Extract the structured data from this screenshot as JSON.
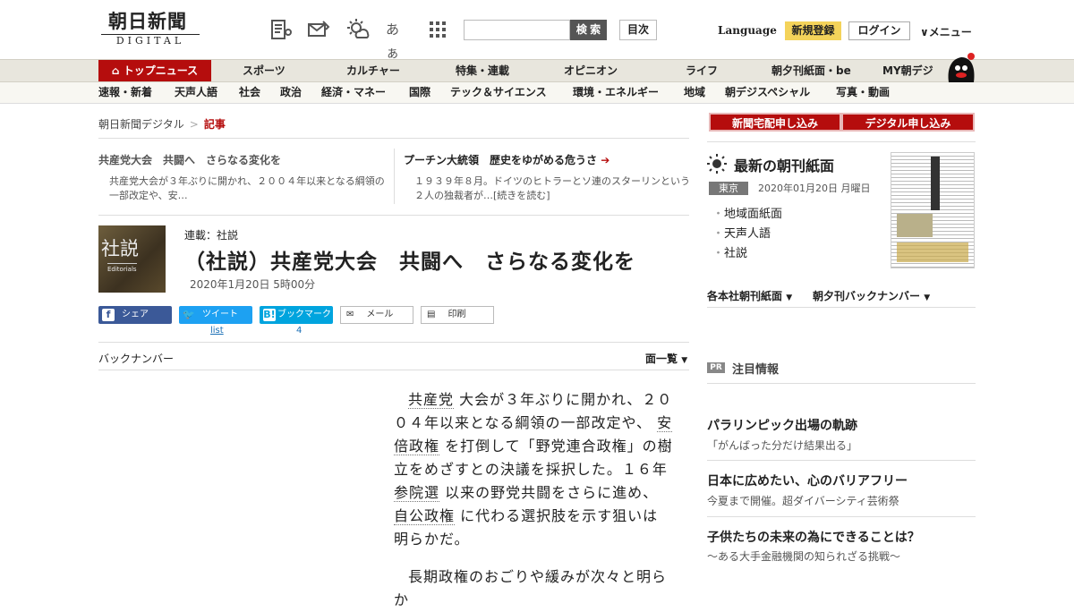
{
  "header": {
    "logo_main": "朝日新聞",
    "logo_sub": "DIGITAL",
    "icon_font_size": "あぁ",
    "search_button": "検 索",
    "toc_button": "目次",
    "language": "Language",
    "register": "新規登録",
    "login": "ログイン",
    "menu": "メニュー"
  },
  "nav_primary": {
    "top_news": "トップニュース",
    "items": [
      "スポーツ",
      "カルチャー",
      "特集・連載",
      "オピニオン",
      "ライフ",
      "朝夕刊紙面・be",
      "MY朝デジ"
    ]
  },
  "nav_secondary": {
    "items": [
      "速報・新着",
      "天声人語",
      "社会",
      "政治",
      "経済・マネー",
      "国際",
      "テック＆サイエンス",
      "環境・エネルギー",
      "地域",
      "朝デジスペシャル",
      "写真・動画"
    ]
  },
  "breadcrumb": {
    "home": "朝日新聞デジタル",
    "sep": ">",
    "current": "記事"
  },
  "related": [
    {
      "title": "共産党大会　共闘へ　さらなる変化を",
      "summary": "共産党大会が３年ぶりに開かれ、２００４年以来となる綱領の一部改定や、安…"
    },
    {
      "title": "プーチン大統領　歴史をゆがめる危うさ",
      "summary": "１９３９年８月。ドイツのヒトラーとソ連のスターリンという２人の独裁者が…",
      "more": "[続きを読む]"
    }
  ],
  "article": {
    "thumb_kanji": "社説",
    "thumb_en": "Editorials",
    "series": "連載：社説",
    "title": "（社説）共産党大会　共闘へ　さらなる変化を",
    "date": "2020年1月20日 5時00分",
    "share": {
      "facebook": "シェア",
      "twitter": "ツイート",
      "twitter_list": "list",
      "hatena": "ブックマーク",
      "hatena_count": "4",
      "mail": "メール",
      "print": "印刷"
    },
    "backnumber": "バックナンバー",
    "men_list": "面一覧",
    "body": [
      [
        "共産党",
        "大会が３年ぶりに開かれ、２００４年以来となる綱領の一部改定や、",
        "安倍政権",
        "を打倒して「野党連合政権」の樹立をめざすとの決議を採択した。１６年",
        "参院選",
        "以来の野党共闘をさらに進め、",
        "自公政権",
        "に代わる選択肢を示す狙いは明らかだ。"
      ],
      [
        "長期政権のおごりや緩みが次々と明らか"
      ]
    ]
  },
  "sidebar": {
    "subscribe_home": "新聞宅配申し込み",
    "subscribe_digital": "デジタル申し込み",
    "latest_title": "最新の朝刊紙面",
    "latest_region": "東京",
    "latest_date": "2020年01月20日 月曜日",
    "latest_items": [
      "地域面紙面",
      "天声人語",
      "社説"
    ],
    "dropdown1": "各本社朝刊紙面",
    "dropdown2": "朝夕刊バックナンバー",
    "pr_badge": "PR",
    "pr_title": "注目情報",
    "pr_items": [
      {
        "head": "パラリンピック出場の軌跡",
        "sub": "「がんばった分だけ結果出る」"
      },
      {
        "head": "日本に広めたい、心のバリアフリー",
        "sub": "今夏まで開催。超ダイバーシティ芸術祭"
      },
      {
        "head": "子供たちの未来の為にできることは？",
        "sub": "～ある大手金融機関の知られざる挑戦～"
      }
    ]
  },
  "colors": {
    "brand_red": "#b50d0d",
    "register_yellow": "#f4d35a",
    "facebook": "#3b5998",
    "twitter": "#1da1f2",
    "hatena": "#00a4de"
  }
}
